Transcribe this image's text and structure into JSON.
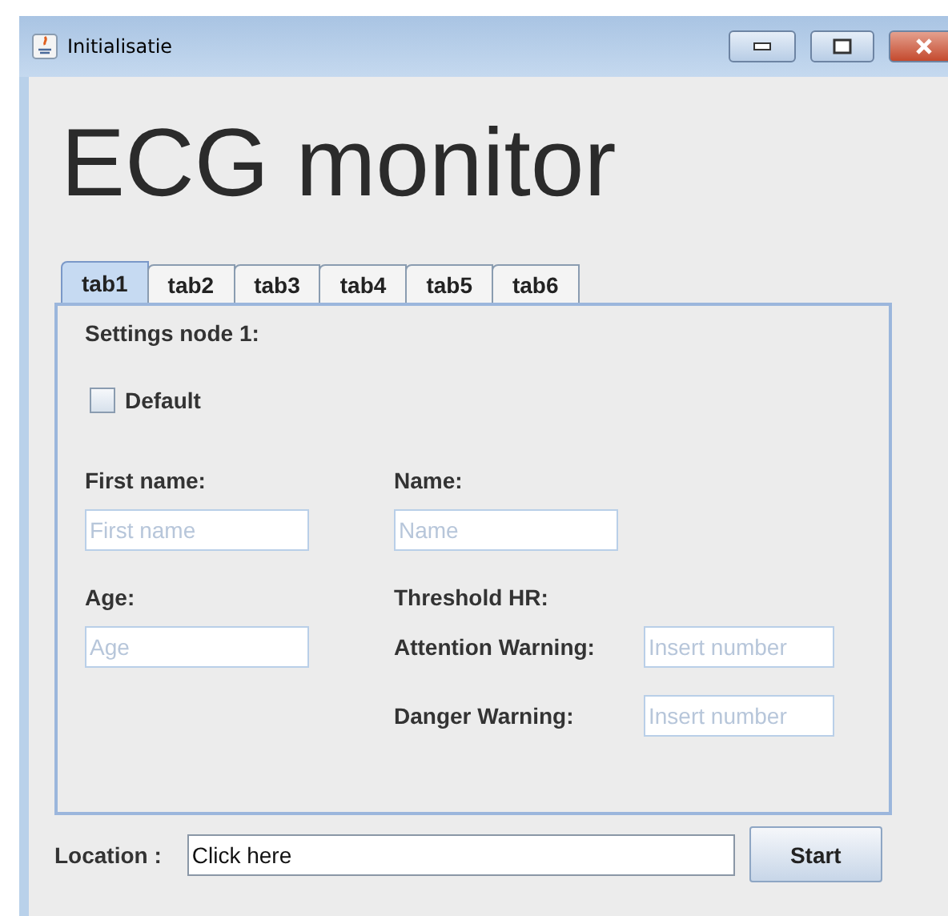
{
  "window": {
    "title": "Initialisatie"
  },
  "heading": "ECG monitor",
  "tabs": [
    {
      "label": "tab1",
      "selected": true
    },
    {
      "label": "tab2",
      "selected": false
    },
    {
      "label": "tab3",
      "selected": false
    },
    {
      "label": "tab4",
      "selected": false
    },
    {
      "label": "tab5",
      "selected": false
    },
    {
      "label": "tab6",
      "selected": false
    }
  ],
  "panel": {
    "title": "Settings node 1:",
    "default_checkbox": {
      "label": "Default",
      "checked": false
    },
    "first_name": {
      "label": "First name:",
      "placeholder": "First name"
    },
    "name": {
      "label": "Name:",
      "placeholder": "Name"
    },
    "age": {
      "label": "Age:",
      "placeholder": "Age"
    },
    "threshold_title": "Threshold HR:",
    "thresholds": [
      {
        "label": "Attention Warning:",
        "placeholder": "Insert number"
      },
      {
        "label": "Danger Warning:",
        "placeholder": "Insert number"
      }
    ]
  },
  "location": {
    "label": "Location :",
    "value": "Click here"
  },
  "start_button": "Start"
}
